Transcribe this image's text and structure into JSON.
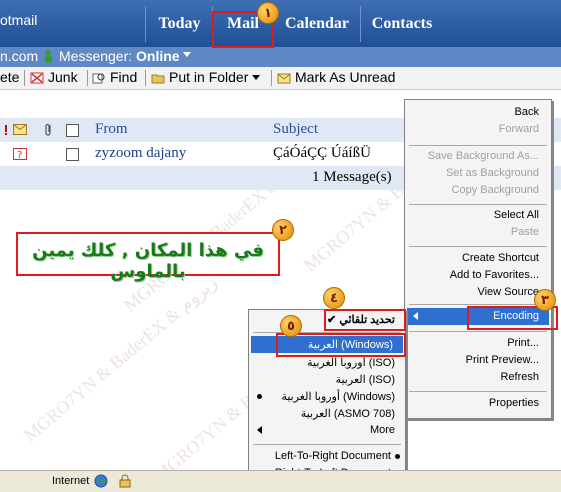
{
  "header": {
    "brand": "otmail",
    "tabs": [
      "Today",
      "Mail",
      "Calendar",
      "Contacts"
    ],
    "domain_fragment": "n.com",
    "messenger_label": "Messenger:",
    "messenger_status": "Online"
  },
  "toolbar": {
    "delete_label": "ete",
    "junk_label": "Junk",
    "find_label": "Find",
    "folder_label": "Put in Folder",
    "unread_label": "Mark As Unread"
  },
  "list": {
    "col_from": "From",
    "col_subject": "Subject",
    "rows": [
      {
        "from": "zyzoom dajany",
        "subject": "ÇáÓáÇÇ ÚáíßÜ"
      }
    ],
    "count": "1 Message(s)"
  },
  "instruction_banner": "في هذا المكان , كلك يمين بالماوس",
  "context_menu": {
    "items": [
      {
        "label": "Back",
        "disabled": false
      },
      {
        "label": "Forward",
        "disabled": true
      },
      {
        "label": "Save Background As...",
        "disabled": true
      },
      {
        "label": "Set as Background",
        "disabled": true
      },
      {
        "label": "Copy Background",
        "disabled": true
      },
      {
        "label": "Select All",
        "disabled": false
      },
      {
        "label": "Paste",
        "disabled": true
      },
      {
        "label": "Create Shortcut",
        "disabled": false
      },
      {
        "label": "Add to Favorites...",
        "disabled": false
      },
      {
        "label": "View Source",
        "disabled": false
      },
      {
        "label": "Encoding",
        "disabled": false
      },
      {
        "label": "Print...",
        "disabled": false
      },
      {
        "label": "Print Preview...",
        "disabled": false
      },
      {
        "label": "Refresh",
        "disabled": false
      },
      {
        "label": "Properties",
        "disabled": false
      }
    ]
  },
  "encoding_menu": {
    "items": [
      {
        "label": "تحديد تلقائي",
        "checked": true
      },
      {
        "label": "العربية (Windows)"
      },
      {
        "label": "أوروبا الغربية (ISO)"
      },
      {
        "label": "العربية (ISO)"
      },
      {
        "label": "أوروبا الغربية (Windows)"
      },
      {
        "label": "العربية (ASMO 708)"
      },
      {
        "label": "More"
      },
      {
        "label": "Left-To-Right Document"
      },
      {
        "label": "Right-To-Left Document"
      }
    ]
  },
  "badges": [
    "١",
    "٢",
    "٣",
    "٤",
    "٥"
  ],
  "status": {
    "zone": "Internet"
  },
  "watermark": "MGRO7YN & BaderEX & زيزوم",
  "colors": {
    "highlight": "#2f6fd0",
    "annotation": "#e01b1b",
    "banner_text": "#1a7a1a"
  }
}
